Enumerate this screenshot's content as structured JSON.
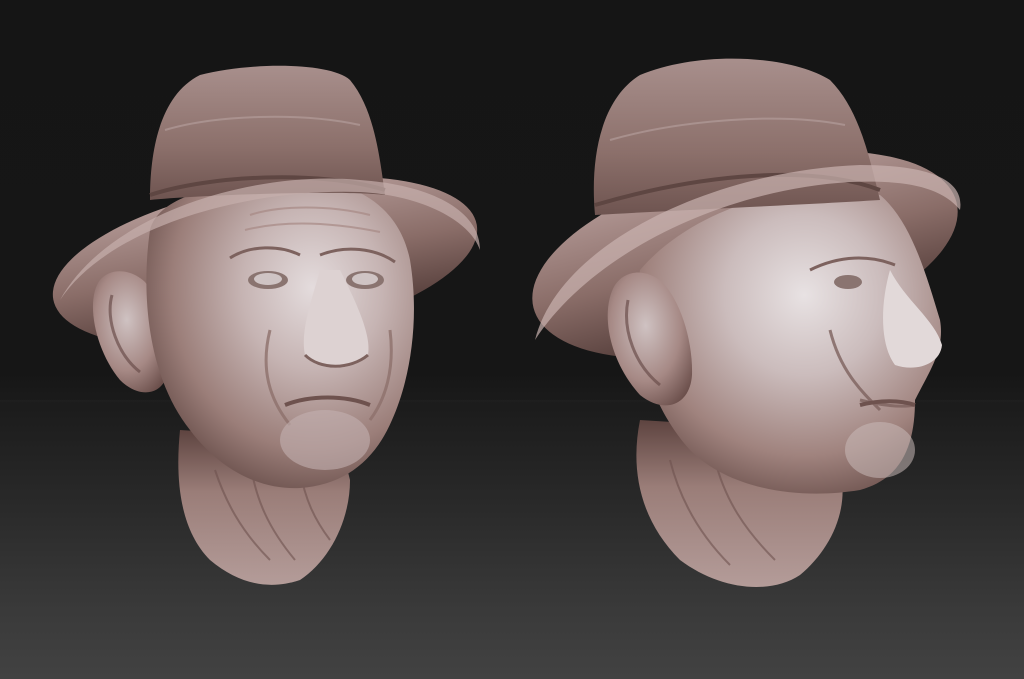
{
  "scene": {
    "background_top": "#151515",
    "background_bottom": "#424242",
    "material_color": "#9b7e79",
    "material_highlight": "#d9cfd0",
    "material_shadow": "#5a413d"
  },
  "sculpts": [
    {
      "name": "front-three-quarter-view",
      "subject": "bust",
      "hat": "bucket-hat"
    },
    {
      "name": "side-profile-view",
      "subject": "bust",
      "hat": "bucket-hat"
    }
  ]
}
